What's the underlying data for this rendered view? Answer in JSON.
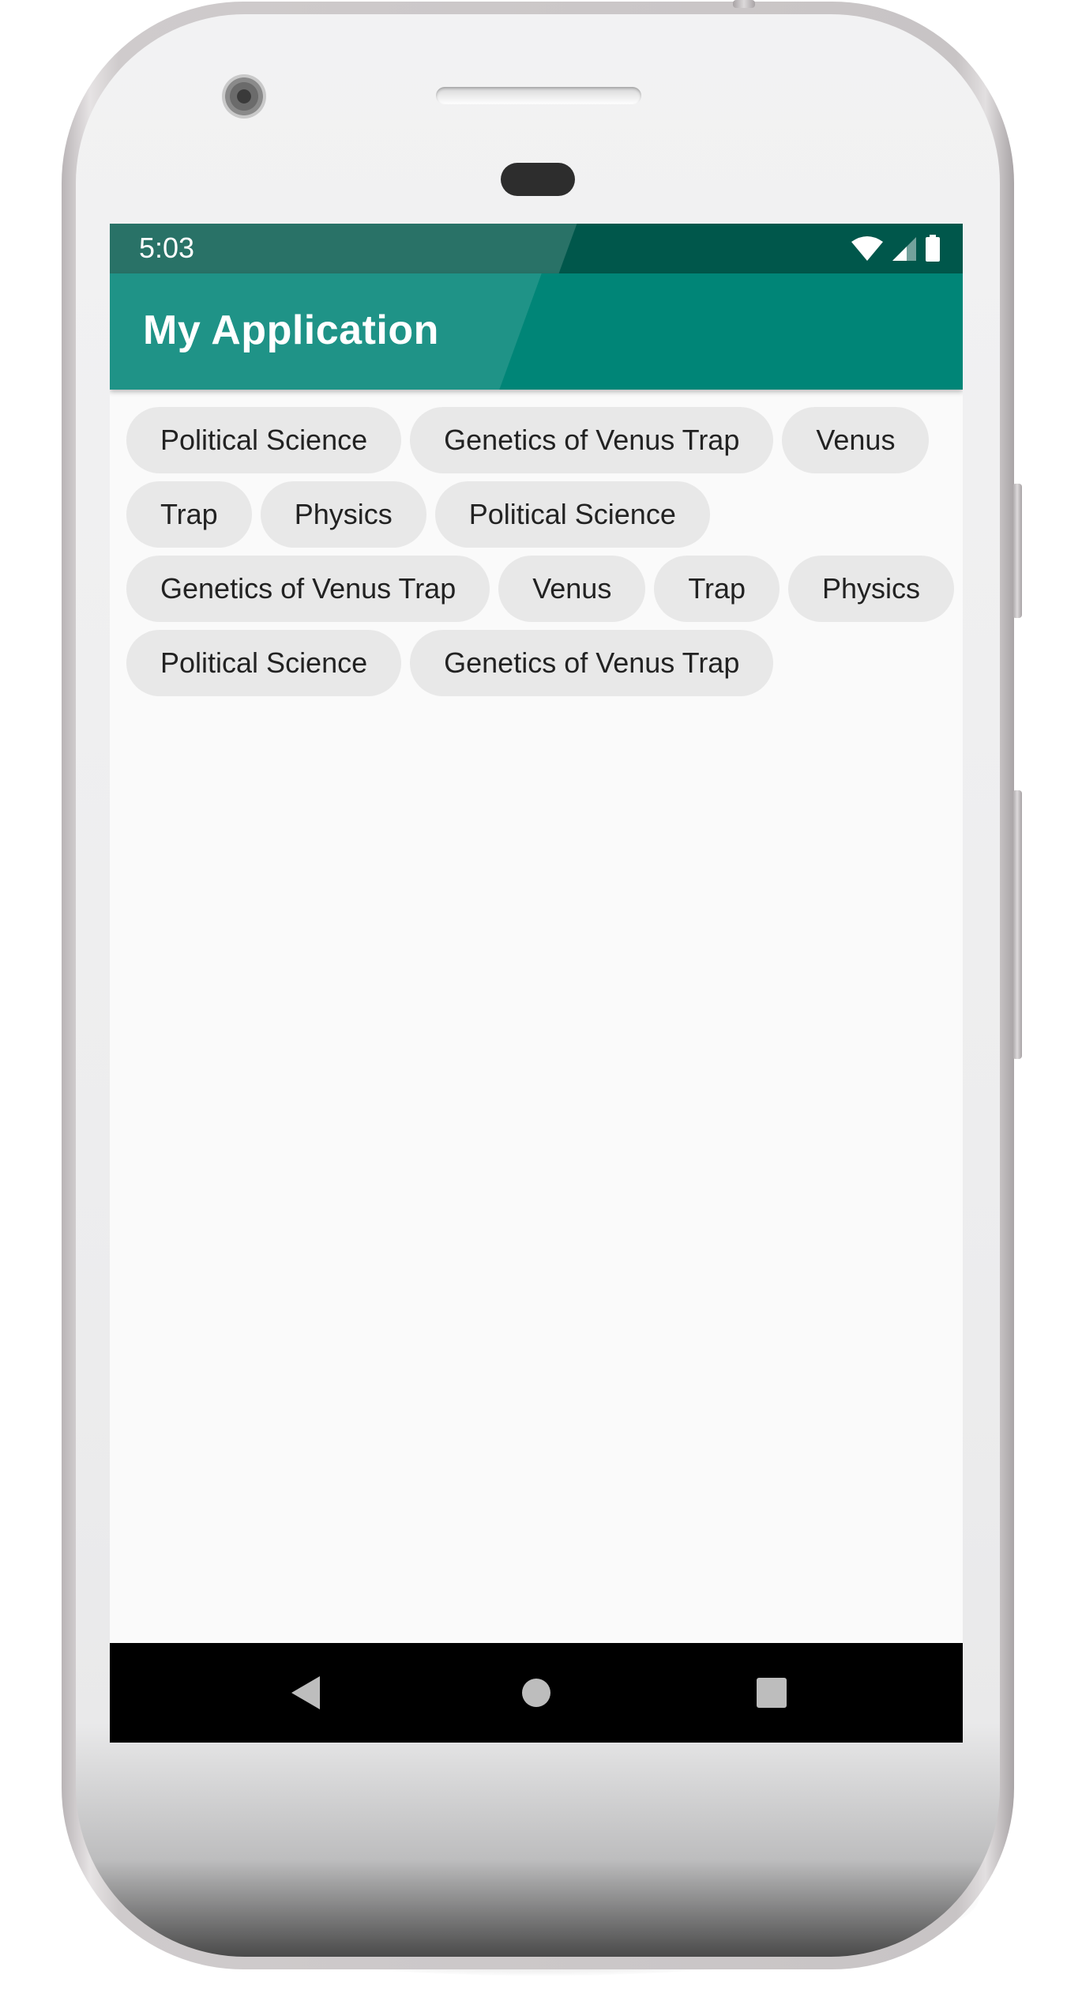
{
  "status_bar": {
    "time": "5:03",
    "icons": [
      "wifi-icon",
      "cell-signal-icon",
      "battery-icon"
    ]
  },
  "app_bar": {
    "title": "My Application",
    "color": "#008577",
    "status_color": "#00574b"
  },
  "chips": {
    "row1": [
      "Political Science",
      "Genetics of Venus Trap",
      "Venus"
    ],
    "row2": [
      "Trap",
      "Physics",
      "Political Science"
    ],
    "row3": [
      "Genetics of Venus Trap",
      "Venus",
      "Trap",
      "Physics"
    ],
    "row4": [
      "Political Science",
      "Genetics of Venus Trap"
    ]
  },
  "nav_bar": {
    "buttons": [
      "back-icon",
      "home-icon",
      "recents-icon"
    ]
  }
}
